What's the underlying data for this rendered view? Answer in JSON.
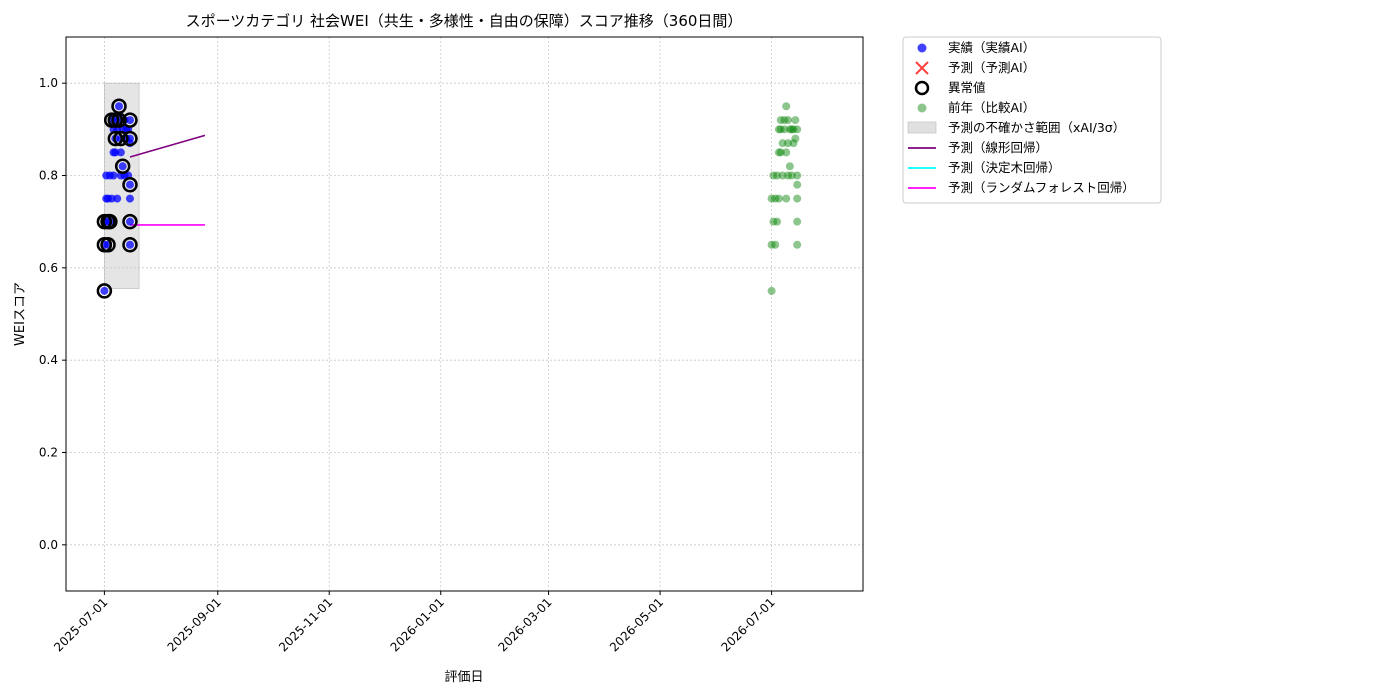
{
  "chart_data": {
    "type": "scatter",
    "title": "スポーツカテゴリ 社会WEI（共生・多様性・自由の保障）スコア推移（360日間）",
    "xlabel": "評価日",
    "ylabel": "WEIスコア",
    "x_type": "date",
    "xlim": [
      "2025-06-10",
      "2026-08-20"
    ],
    "ylim": [
      -0.1,
      1.1
    ],
    "yticks": [
      0.0,
      0.2,
      0.4,
      0.6,
      0.8,
      1.0
    ],
    "ytick_labels": [
      "0.0",
      "0.2",
      "0.4",
      "0.6",
      "0.8",
      "1.0"
    ],
    "xticks": [
      "2025-07-01",
      "2025-09-01",
      "2025-11-01",
      "2026-01-01",
      "2026-03-01",
      "2026-05-01",
      "2026-07-01"
    ],
    "xtick_labels": [
      "2025-07-01",
      "2025-09-01",
      "2025-11-01",
      "2026-01-01",
      "2026-03-01",
      "2026-05-01",
      "2026-07-01"
    ],
    "grid": true,
    "legend_position": "outside-top-right",
    "colors": {
      "actual": "#0000ff",
      "predicted": "#ff0000",
      "anomaly": "#000000",
      "previous_year": "#008000",
      "uncertainty": "#cccccc",
      "linear": "#800080",
      "tree": "#00ffff",
      "forest": "#ff00ff"
    },
    "legend": [
      {
        "key": "actual",
        "label": "実績（実績AI）"
      },
      {
        "key": "predicted",
        "label": "予測（予測AI）"
      },
      {
        "key": "anomaly",
        "label": "異常値"
      },
      {
        "key": "previous_year",
        "label": "前年（比較AI）"
      },
      {
        "key": "uncertainty",
        "label": "予測の不確かさ範囲（xAI/3σ）"
      },
      {
        "key": "linear",
        "label": "予測（線形回帰）"
      },
      {
        "key": "tree",
        "label": "予測（決定木回帰）"
      },
      {
        "key": "forest",
        "label": "予測（ランダムフォレスト回帰）"
      }
    ],
    "uncertainty_band": {
      "x": [
        "2025-07-01",
        "2025-07-20"
      ],
      "y": [
        0.555,
        1.0
      ]
    },
    "series": [
      {
        "name": "実績（実績AI）",
        "kind": "actual",
        "points": [
          [
            "2025-07-01",
            0.55
          ],
          [
            "2025-07-01",
            0.65
          ],
          [
            "2025-07-01",
            0.7
          ],
          [
            "2025-07-02",
            0.75
          ],
          [
            "2025-07-02",
            0.8
          ],
          [
            "2025-07-03",
            0.65
          ],
          [
            "2025-07-03",
            0.7
          ],
          [
            "2025-07-03",
            0.75
          ],
          [
            "2025-07-04",
            0.7
          ],
          [
            "2025-07-04",
            0.8
          ],
          [
            "2025-07-05",
            0.75
          ],
          [
            "2025-07-05",
            0.92
          ],
          [
            "2025-07-06",
            0.85
          ],
          [
            "2025-07-06",
            0.9
          ],
          [
            "2025-07-06",
            0.8
          ],
          [
            "2025-07-07",
            0.92
          ],
          [
            "2025-07-07",
            0.88
          ],
          [
            "2025-07-07",
            0.85
          ],
          [
            "2025-07-08",
            0.9
          ],
          [
            "2025-07-08",
            0.75
          ],
          [
            "2025-07-09",
            0.95
          ],
          [
            "2025-07-09",
            0.92
          ],
          [
            "2025-07-10",
            0.88
          ],
          [
            "2025-07-10",
            0.85
          ],
          [
            "2025-07-10",
            0.8
          ],
          [
            "2025-07-11",
            0.9
          ],
          [
            "2025-07-11",
            0.82
          ],
          [
            "2025-07-12",
            0.92
          ],
          [
            "2025-07-12",
            0.8
          ],
          [
            "2025-07-13",
            0.9
          ],
          [
            "2025-07-13",
            0.88
          ],
          [
            "2025-07-14",
            0.8
          ],
          [
            "2025-07-14",
            0.9
          ],
          [
            "2025-07-15",
            0.75
          ],
          [
            "2025-07-15",
            0.7
          ],
          [
            "2025-07-15",
            0.65
          ],
          [
            "2025-07-15",
            0.88
          ],
          [
            "2025-07-15",
            0.92
          ],
          [
            "2025-07-15",
            0.78
          ],
          [
            "2025-07-15",
            0.87
          ]
        ]
      },
      {
        "name": "異常値",
        "kind": "anomaly",
        "points": [
          [
            "2025-07-01",
            0.55
          ],
          [
            "2025-07-01",
            0.65
          ],
          [
            "2025-07-01",
            0.7
          ],
          [
            "2025-07-03",
            0.65
          ],
          [
            "2025-07-03",
            0.7
          ],
          [
            "2025-07-04",
            0.7
          ],
          [
            "2025-07-05",
            0.92
          ],
          [
            "2025-07-07",
            0.92
          ],
          [
            "2025-07-07",
            0.88
          ],
          [
            "2025-07-09",
            0.95
          ],
          [
            "2025-07-09",
            0.92
          ],
          [
            "2025-07-10",
            0.88
          ],
          [
            "2025-07-11",
            0.82
          ],
          [
            "2025-07-15",
            0.92
          ],
          [
            "2025-07-15",
            0.88
          ],
          [
            "2025-07-15",
            0.78
          ],
          [
            "2025-07-15",
            0.7
          ],
          [
            "2025-07-15",
            0.65
          ]
        ]
      },
      {
        "name": "前年（比較AI）",
        "kind": "previous_year",
        "points": [
          [
            "2026-07-01",
            0.55
          ],
          [
            "2026-07-01",
            0.65
          ],
          [
            "2026-07-01",
            0.75
          ],
          [
            "2026-07-02",
            0.7
          ],
          [
            "2026-07-02",
            0.8
          ],
          [
            "2026-07-03",
            0.65
          ],
          [
            "2026-07-03",
            0.75
          ],
          [
            "2026-07-04",
            0.7
          ],
          [
            "2026-07-04",
            0.8
          ],
          [
            "2026-07-05",
            0.85
          ],
          [
            "2026-07-05",
            0.9
          ],
          [
            "2026-07-05",
            0.75
          ],
          [
            "2026-07-06",
            0.92
          ],
          [
            "2026-07-06",
            0.85
          ],
          [
            "2026-07-06",
            0.9
          ],
          [
            "2026-07-07",
            0.87
          ],
          [
            "2026-07-07",
            0.8
          ],
          [
            "2026-07-08",
            0.9
          ],
          [
            "2026-07-08",
            0.92
          ],
          [
            "2026-07-09",
            0.75
          ],
          [
            "2026-07-09",
            0.95
          ],
          [
            "2026-07-09",
            0.85
          ],
          [
            "2026-07-10",
            0.92
          ],
          [
            "2026-07-10",
            0.87
          ],
          [
            "2026-07-10",
            0.8
          ],
          [
            "2026-07-11",
            0.9
          ],
          [
            "2026-07-11",
            0.82
          ],
          [
            "2026-07-12",
            0.8
          ],
          [
            "2026-07-12",
            0.9
          ],
          [
            "2026-07-13",
            0.9
          ],
          [
            "2026-07-13",
            0.87
          ],
          [
            "2026-07-14",
            0.92
          ],
          [
            "2026-07-14",
            0.88
          ],
          [
            "2026-07-15",
            0.9
          ],
          [
            "2026-07-15",
            0.8
          ],
          [
            "2026-07-15",
            0.75
          ],
          [
            "2026-07-15",
            0.7
          ],
          [
            "2026-07-15",
            0.65
          ],
          [
            "2026-07-15",
            0.78
          ]
        ]
      }
    ],
    "prediction_lines": [
      {
        "name": "予測（線形回帰）",
        "kind": "linear",
        "x": [
          "2025-07-15",
          "2025-08-25"
        ],
        "y": [
          0.84,
          0.887
        ]
      },
      {
        "name": "予測（ランダムフォレスト回帰）",
        "kind": "forest",
        "x": [
          "2025-07-15",
          "2025-08-25"
        ],
        "y": [
          0.693,
          0.693
        ]
      }
    ]
  }
}
